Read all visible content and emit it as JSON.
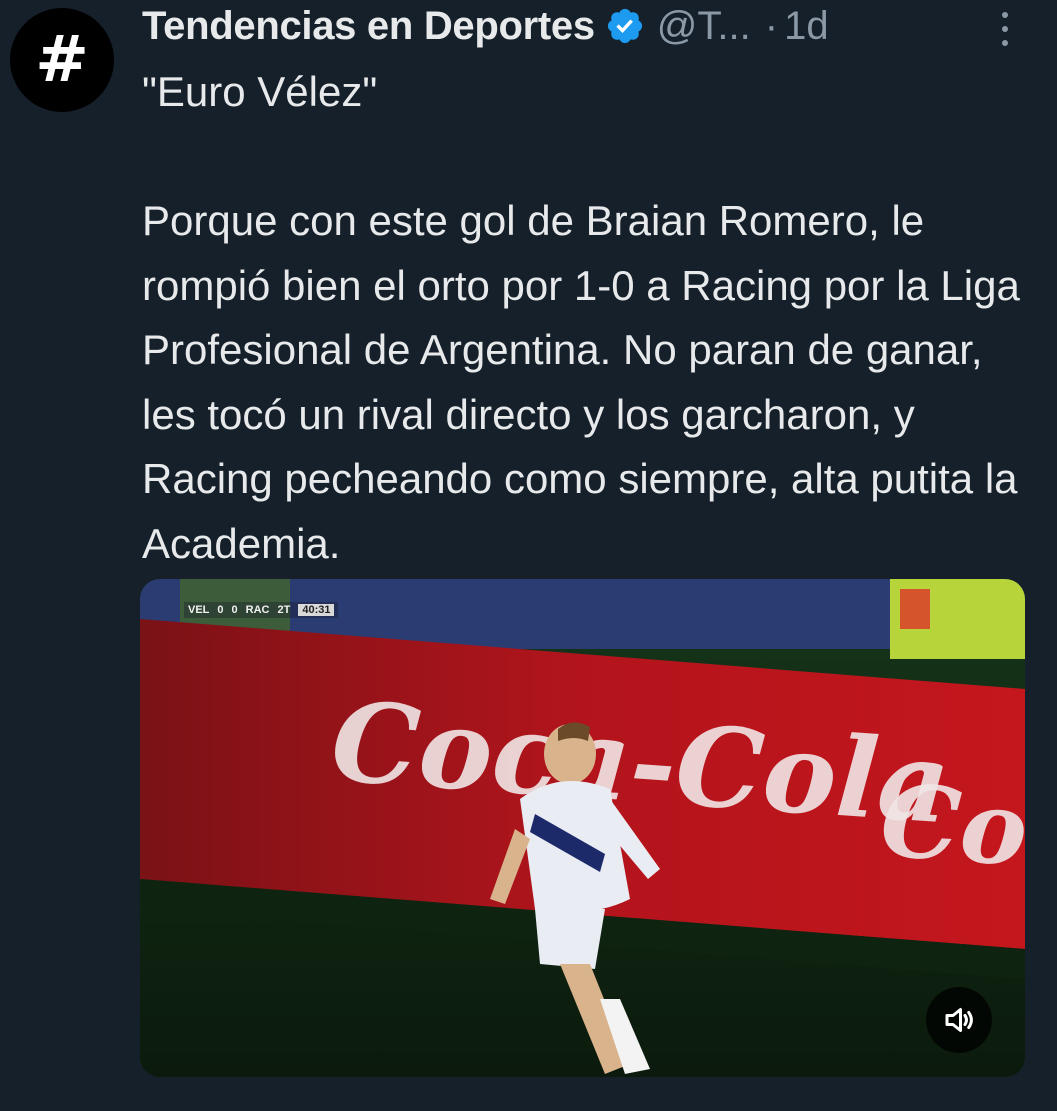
{
  "tweet": {
    "avatar_symbol": "#",
    "display_name": "Tendencias en Deportes",
    "verified": true,
    "verified_color": "#1d9bf0",
    "handle": "@T...",
    "separator": "·",
    "time": "1d",
    "text": "\"Euro Vélez\"\n\nPorque con este gol de Braian Romero, le rompió bien el orto por 1-0 a Racing por la Liga Profesional de Argentina. No paran de ganar, les tocó un rival directo y los garcharon, y Racing pecheando como siempre, alta putita la Academia."
  },
  "media": {
    "type": "video",
    "scorebug": {
      "home": "VEL",
      "home_score": "0",
      "away_score": "0",
      "away": "RAC",
      "period": "2T",
      "clock": "40:31"
    },
    "billboard_text": "Coca-Cola",
    "sound_icon": "speaker-icon"
  },
  "colors": {
    "background": "#15202b",
    "text_primary": "#e7e9ea",
    "text_secondary": "#8b98a5"
  }
}
